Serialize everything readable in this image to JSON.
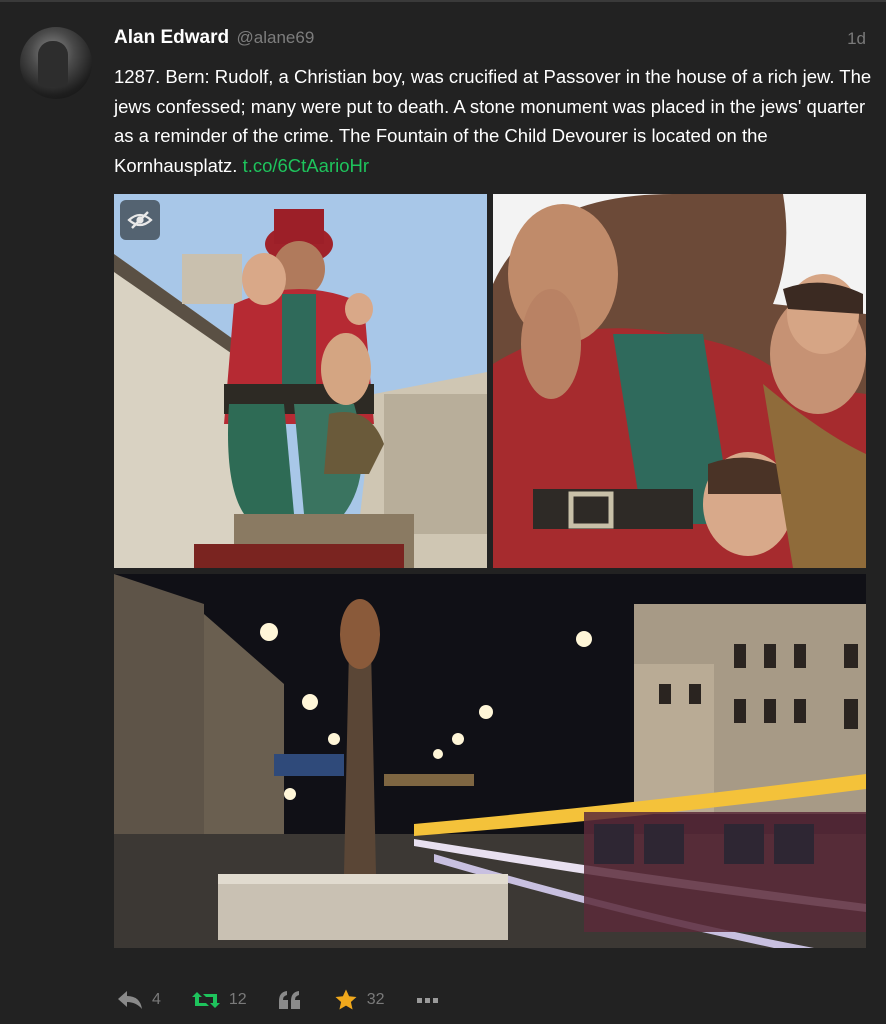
{
  "post": {
    "author_name": "Alan Edward",
    "author_handle": "@alane69",
    "time": "1d",
    "text": "1287. Bern: Rudolf, a Christian boy, was crucified at Passover in the house of a rich jew. The jews confessed; many were put to death. A stone monument was placed in the jews' quarter as a reminder of the crime. The Fountain of the Child Devourer is located on the Kornhausplatz.",
    "link": "t.co/6CtAarioHr"
  },
  "media": {
    "hide_icon": "eye-slash-icon"
  },
  "actions": {
    "reply_count": "4",
    "boost_count": "12",
    "favourite_count": "32",
    "reply_icon": "reply-icon",
    "boost_icon": "boost-icon",
    "quote_icon": "quote-icon",
    "favourite_icon": "star-icon",
    "more_icon": "more-icon"
  },
  "colors": {
    "background": "#222222",
    "link": "#1ec35c",
    "boost": "#1ec35c",
    "star": "#f0a81c",
    "muted": "#7a7a7a"
  }
}
